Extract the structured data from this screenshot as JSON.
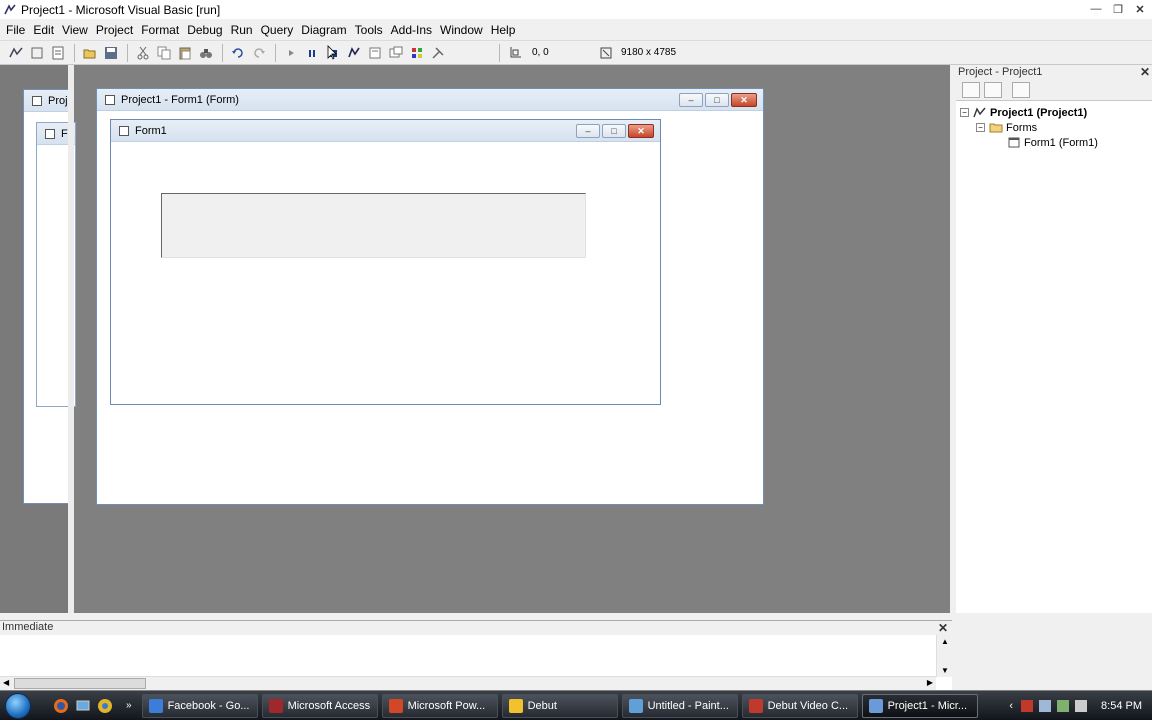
{
  "window": {
    "title": "Project1 - Microsoft Visual Basic [run]"
  },
  "menu": [
    {
      "label": "File"
    },
    {
      "label": "Edit"
    },
    {
      "label": "View"
    },
    {
      "label": "Project"
    },
    {
      "label": "Format"
    },
    {
      "label": "Debug"
    },
    {
      "label": "Run"
    },
    {
      "label": "Query"
    },
    {
      "label": "Diagram"
    },
    {
      "label": "Tools"
    },
    {
      "label": "Add-Ins"
    },
    {
      "label": "Window"
    },
    {
      "label": "Help"
    }
  ],
  "toolbar": {
    "position": "0, 0",
    "size": "9180 x 4785"
  },
  "windows": {
    "back_title": "Proj",
    "back_inner_title": "F",
    "designer_title": "Project1 - Form1 (Form)",
    "form_title": "Form1"
  },
  "project_pane": {
    "title": "Project - Project1",
    "root": "Project1 (Project1)",
    "folder": "Forms",
    "item": "Form1 (Form1)"
  },
  "immediate": {
    "title": "Immediate"
  },
  "taskbar": {
    "tasks": [
      {
        "label": "Facebook - Go...",
        "color": "#3b7dd8"
      },
      {
        "label": "Microsoft Access",
        "color": "#a0282d"
      },
      {
        "label": "Microsoft Pow...",
        "color": "#d24726"
      },
      {
        "label": "Debut",
        "color": "#f2c12e"
      },
      {
        "label": "Untitled - Paint...",
        "color": "#5fa0d6"
      },
      {
        "label": "Debut Video C...",
        "color": "#c0392b"
      },
      {
        "label": "Project1 - Micr...",
        "color": "#6a9bd8"
      }
    ],
    "clock": "8:54 PM"
  }
}
